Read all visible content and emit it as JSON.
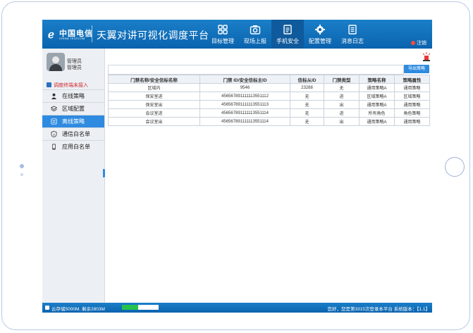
{
  "header": {
    "logo_text": "中国电信",
    "logo_en": "CHINA TELECOM",
    "title": "天翼对讲可视化调度平台",
    "nav": [
      {
        "label": "目标管理",
        "icon": "grid-icon"
      },
      {
        "label": "现场上报",
        "icon": "camera-icon"
      },
      {
        "label": "手机安全",
        "icon": "clipboard-icon"
      },
      {
        "label": "配置管理",
        "icon": "gear-icon"
      },
      {
        "label": "消息日志",
        "icon": "list-icon"
      }
    ],
    "active_nav": "手机安全",
    "logout": "注销"
  },
  "sidebar": {
    "user_name": "管理员",
    "user_role": "管理员",
    "warning": "调度终端未接入",
    "items": [
      {
        "label": "在线策略",
        "icon": "person-icon"
      },
      {
        "label": "区域配置",
        "icon": "layers-icon"
      },
      {
        "label": "离线策略",
        "icon": "offline-icon"
      },
      {
        "label": "通信白名单",
        "icon": "shield-icon"
      },
      {
        "label": "应用白名单",
        "icon": "phone-icon"
      }
    ],
    "active_item": "离线策略"
  },
  "toolbar": {
    "export_label": "导出策略"
  },
  "table": {
    "columns": [
      "门禁名称/安全信标名称",
      "门禁 ID/安全信标主ID",
      "信标从ID",
      "门禁类型",
      "策略名称",
      "策略属性"
    ],
    "rows": [
      [
        "区域内",
        "9546",
        "23288",
        "无",
        "通用策略A",
        "通用策略"
      ],
      [
        "保安室进",
        "456567891111113551112",
        "无",
        "进",
        "区域策略A",
        "区域策略"
      ],
      [
        "保安室出",
        "456567891111113551113",
        "无",
        "出",
        "通用策略A",
        "通用策略"
      ],
      [
        "会议室进",
        "456567891111113551114",
        "无",
        "进",
        "所有角色",
        "角色策略"
      ],
      [
        "会议室出",
        "456567891111113551114",
        "无",
        "出",
        "通用策略A",
        "通用策略"
      ]
    ]
  },
  "status": {
    "storage": "云存储5000M, 剩余2803M",
    "usage_fraction": 0.44,
    "welcome": "您好，您是第3315次登录本平台 系统版本：【1.1】"
  },
  "colors": {
    "header_blue": "#0b63ae",
    "active_blue": "#2f8be0",
    "warning_red": "#d0282e",
    "progress_green": "#27c24c"
  }
}
